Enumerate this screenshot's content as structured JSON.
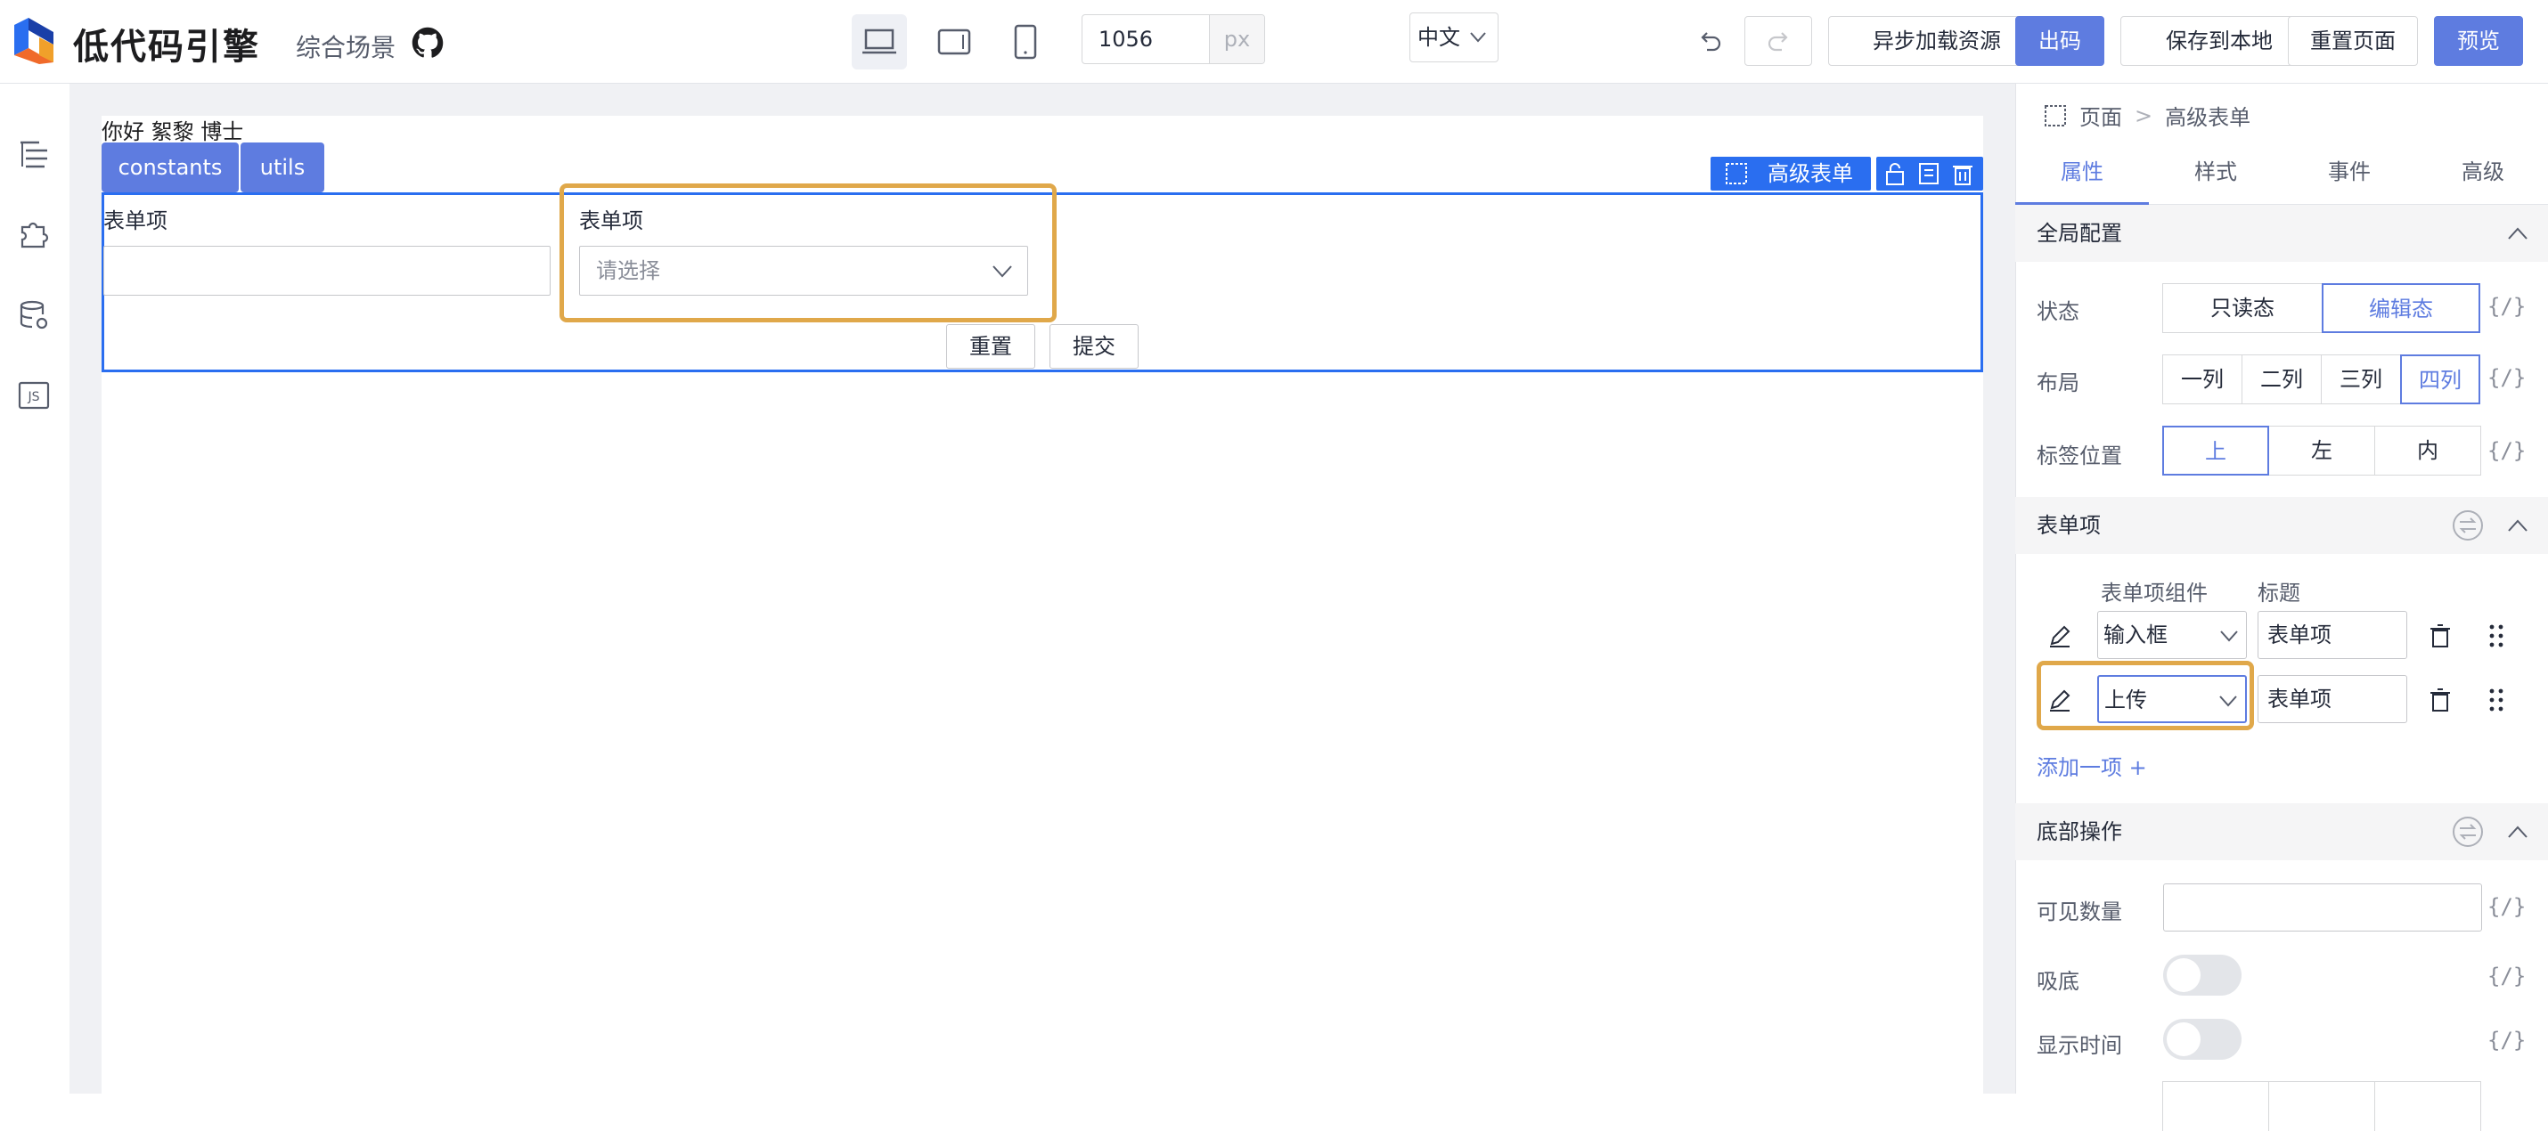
{
  "header": {
    "logo_text": "低代码引擎",
    "scene_label": "综合场景",
    "canvas_width": "1056",
    "canvas_unit": "px",
    "lang": "中文",
    "buttons": {
      "async_load": "异步加载资源",
      "output_code": "出码",
      "save_local": "保存到本地",
      "reset_page": "重置页面",
      "preview": "预览"
    }
  },
  "canvas": {
    "greeting": "你好 絮黎 博士",
    "chips": [
      "constants",
      "utils"
    ],
    "component_badge": "高级表单",
    "form": {
      "field1_label": "表单项",
      "field2_label": "表单项",
      "select_placeholder": "请选择",
      "reset": "重置",
      "submit": "提交"
    }
  },
  "panel": {
    "breadcrumb": [
      "页面",
      "高级表单"
    ],
    "tabs": [
      "属性",
      "样式",
      "事件",
      "高级"
    ],
    "active_tab": "属性",
    "sections": {
      "global": "全局配置",
      "items": "表单项",
      "bottom": "底部操作"
    },
    "status": {
      "label": "状态",
      "options": [
        "只读态",
        "编辑态"
      ],
      "selected": "编辑态"
    },
    "layout": {
      "label": "布局",
      "options": [
        "一列",
        "二列",
        "三列",
        "四列"
      ],
      "selected": "四列"
    },
    "label_pos": {
      "label": "标签位置",
      "options": [
        "上",
        "左",
        "内"
      ],
      "selected": "上"
    },
    "items_table": {
      "col_component": "表单项组件",
      "col_title": "标题",
      "rows": [
        {
          "component": "输入框",
          "title": "表单项"
        },
        {
          "component": "上传",
          "title": "表单项"
        }
      ],
      "add": "添加一项 +"
    },
    "bottom": {
      "visible_count": "可见数量",
      "sticky": "吸底",
      "show_time": "显示时间"
    },
    "expr": "{/}"
  }
}
